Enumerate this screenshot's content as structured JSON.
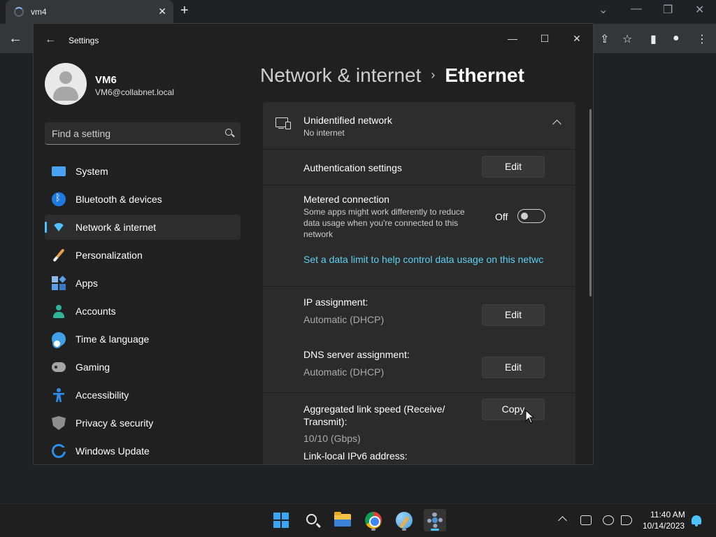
{
  "browser": {
    "tab_title": "vm4",
    "tab_close": "✕",
    "new_tab": "+",
    "minimize": "⌄",
    "restore": "—",
    "maximize": "❐",
    "close": "✕"
  },
  "window": {
    "title": "Settings",
    "minimize": "—",
    "maximize": "☐",
    "close": "✕"
  },
  "profile": {
    "name": "VM6",
    "email": "VM6@collabnet.local"
  },
  "search": {
    "placeholder": "Find a setting"
  },
  "sidebar": {
    "items": [
      {
        "label": "System",
        "icon": "system-icon"
      },
      {
        "label": "Bluetooth & devices",
        "icon": "bluetooth-icon"
      },
      {
        "label": "Network & internet",
        "icon": "wifi-icon",
        "selected": true
      },
      {
        "label": "Personalization",
        "icon": "brush-icon"
      },
      {
        "label": "Apps",
        "icon": "apps-icon"
      },
      {
        "label": "Accounts",
        "icon": "person-icon"
      },
      {
        "label": "Time & language",
        "icon": "globe-clock-icon"
      },
      {
        "label": "Gaming",
        "icon": "gamepad-icon"
      },
      {
        "label": "Accessibility",
        "icon": "accessibility-icon"
      },
      {
        "label": "Privacy & security",
        "icon": "shield-icon"
      },
      {
        "label": "Windows Update",
        "icon": "update-icon"
      }
    ]
  },
  "breadcrumb": {
    "parent": "Network & internet",
    "separator": "›",
    "current": "Ethernet"
  },
  "network": {
    "name": "Unidentified network",
    "status": "No internet"
  },
  "auth": {
    "label": "Authentication settings",
    "button": "Edit"
  },
  "metered": {
    "label": "Metered connection",
    "description": "Some apps might work differently to reduce data usage when you're connected to this network",
    "state_label": "Off",
    "on": false
  },
  "data_limit_link": "Set a data limit to help control data usage on this netwc",
  "ip": {
    "label": "IP assignment:",
    "value": "Automatic (DHCP)",
    "button": "Edit"
  },
  "dns": {
    "label": "DNS server assignment:",
    "value": "Automatic (DHCP)",
    "button": "Edit"
  },
  "link_speed": {
    "label": "Aggregated link speed (Receive/ Transmit):",
    "value": "10/10 (Gbps)",
    "button": "Copy"
  },
  "ipv6": {
    "label": "Link-local IPv6 address:"
  },
  "taskbar": {
    "time": "11:40 AM",
    "date": "10/14/2023"
  }
}
